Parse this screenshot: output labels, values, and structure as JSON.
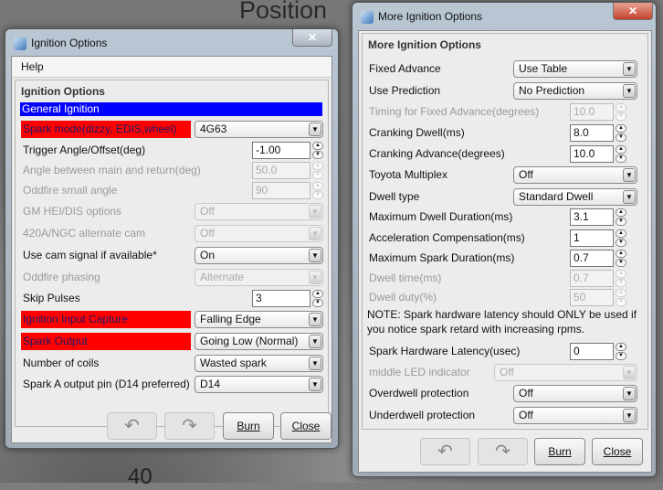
{
  "background": {
    "gauge_label": "Position",
    "gauge_number": "40"
  },
  "left_window": {
    "title": "Ignition Options",
    "close_glyph": "✕",
    "menu": [
      "Help"
    ],
    "panel_title": "Ignition Options",
    "section_header": "General Ignition",
    "rows": [
      {
        "label": "Spark mode(dizzy, EDIS,wheel)",
        "type": "combo",
        "value": "4G63",
        "highlight": true
      },
      {
        "label": "Trigger Angle/Offset(deg)",
        "type": "spin",
        "value": "-1.00"
      },
      {
        "label": "Angle between main and return(deg)",
        "type": "spin",
        "value": "50.0",
        "disabled": true
      },
      {
        "label": "Oddfire small angle",
        "type": "spin",
        "value": "90",
        "disabled": true
      },
      {
        "label": "GM HEI/DIS options",
        "type": "combo",
        "value": "Off",
        "disabled": true
      },
      {
        "label": "420A/NGC alternate cam",
        "type": "combo",
        "value": "Off",
        "disabled": true
      },
      {
        "label": "Use cam signal if available*",
        "type": "combo",
        "value": "On"
      },
      {
        "label": "Oddfire phasing",
        "type": "combo",
        "value": "Alternate",
        "disabled": true
      },
      {
        "label": "Skip Pulses",
        "type": "spin",
        "value": "3"
      },
      {
        "label": "Ignition Input Capture",
        "type": "combo",
        "value": "Falling Edge",
        "highlight": true
      },
      {
        "label": "Spark Output",
        "type": "combo",
        "value": "Going Low (Normal)",
        "highlight": true
      },
      {
        "label": "Number of coils",
        "type": "combo",
        "value": "Wasted spark"
      },
      {
        "label": "Spark A output pin (D14 preferred)",
        "type": "combo",
        "value": "D14"
      }
    ],
    "buttons": {
      "undo": "↶",
      "redo": "↷",
      "burn": "Burn",
      "close": "Close"
    }
  },
  "right_window": {
    "title": "More Ignition Options",
    "close_glyph": "✕",
    "panel_title": "More Ignition Options",
    "rows": [
      {
        "label": "Fixed Advance",
        "type": "combo",
        "value": "Use Table"
      },
      {
        "label": "Use Prediction",
        "type": "combo",
        "value": "No Prediction"
      },
      {
        "label": "Timing for Fixed Advance(degrees)",
        "type": "spin",
        "value": "10.0",
        "disabled": true
      },
      {
        "label": "Cranking Dwell(ms)",
        "type": "spin",
        "value": "8.0"
      },
      {
        "label": "Cranking Advance(degrees)",
        "type": "spin",
        "value": "10.0"
      },
      {
        "label": "Toyota Multiplex",
        "type": "combo",
        "value": "Off"
      },
      {
        "label": "Dwell type",
        "type": "combo",
        "value": "Standard Dwell"
      },
      {
        "label": "Maximum Dwell Duration(ms)",
        "type": "spin",
        "value": "3.1"
      },
      {
        "label": "Acceleration Compensation(ms)",
        "type": "spin",
        "value": "1"
      },
      {
        "label": "Maximum Spark Duration(ms)",
        "type": "spin",
        "value": "0.7"
      },
      {
        "label": "Dwell time(ms)",
        "type": "spin",
        "value": "0.7",
        "disabled": true
      },
      {
        "label": "Dwell duty(%)",
        "type": "spin",
        "value": "50",
        "disabled": true
      },
      {
        "label": "NOTE: Spark hardware latency should ONLY be used if",
        "type": "note"
      },
      {
        "label": "you notice spark retard with increasing rpms.",
        "type": "note"
      },
      {
        "label": "Spark Hardware Latency(usec)",
        "type": "spin",
        "value": "0"
      },
      {
        "label": "middle LED indicator",
        "type": "combo",
        "value": "Off",
        "disabled": true,
        "wide": true
      },
      {
        "label": "Overdwell protection",
        "type": "combo",
        "value": "Off"
      },
      {
        "label": "Underdwell protection",
        "type": "combo",
        "value": "Off"
      }
    ],
    "buttons": {
      "undo": "↶",
      "redo": "↷",
      "burn": "Burn",
      "close": "Close"
    }
  }
}
